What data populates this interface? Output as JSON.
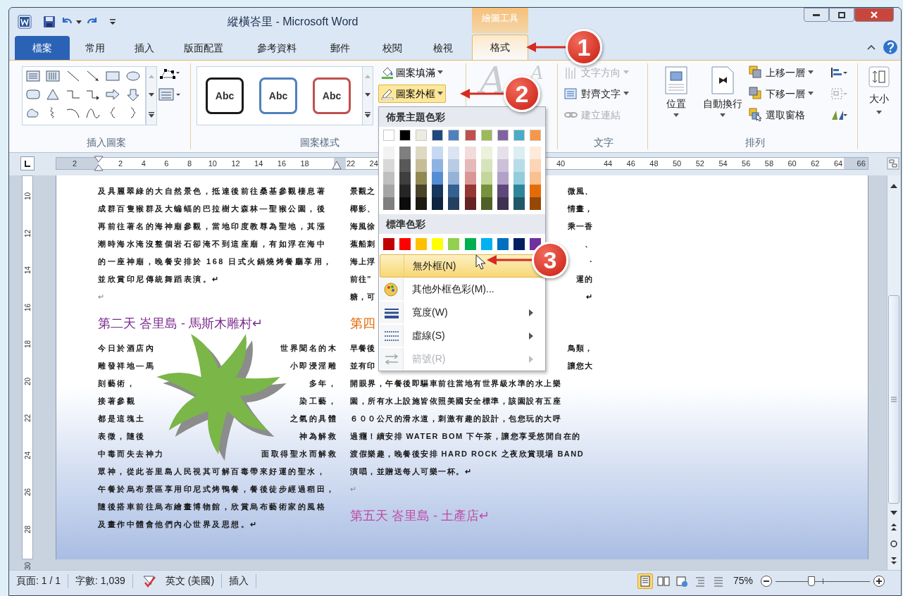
{
  "window": {
    "title": "縱橫峇里 - Microsoft Word",
    "contextual_tab_group": "繪圖工具"
  },
  "tabs": [
    {
      "label": "檔案",
      "kind": "file",
      "selected": false
    },
    {
      "label": "常用",
      "kind": "tab",
      "selected": false
    },
    {
      "label": "插入",
      "kind": "tab",
      "selected": false
    },
    {
      "label": "版面配置",
      "kind": "tab",
      "selected": false
    },
    {
      "label": "參考資料",
      "kind": "tab",
      "selected": false
    },
    {
      "label": "郵件",
      "kind": "tab",
      "selected": false
    },
    {
      "label": "校閱",
      "kind": "tab",
      "selected": false
    },
    {
      "label": "檢視",
      "kind": "tab",
      "selected": false
    },
    {
      "label": "格式",
      "kind": "contextual",
      "selected": true
    }
  ],
  "ribbon": {
    "insert_shapes": {
      "label": "插入圖案"
    },
    "shape_styles": {
      "label": "圖案樣式",
      "presets": [
        {
          "text": "Abc",
          "color": "#1a1a1a"
        },
        {
          "text": "Abc",
          "color": "#4f81bd"
        },
        {
          "text": "Abc",
          "color": "#c0504d"
        }
      ],
      "commands": [
        {
          "label": "圖案填滿",
          "pressed": false
        },
        {
          "label": "圖案外框",
          "pressed": true
        }
      ]
    },
    "wordart_styles": {
      "glyphs": [
        "A",
        "A"
      ]
    },
    "text_group": {
      "label": "文字",
      "commands": [
        {
          "label": "文字方向",
          "disabled": true
        },
        {
          "label": "對齊文字",
          "disabled": false
        },
        {
          "label": "建立連結",
          "disabled": true
        }
      ]
    },
    "arrange": {
      "label": "排列",
      "large": [
        {
          "label": "位置"
        },
        {
          "label": "自動換行"
        }
      ],
      "commands": [
        {
          "label": "上移一層"
        },
        {
          "label": "下移一層"
        },
        {
          "label": "選取窗格"
        }
      ]
    },
    "size": {
      "label": "大小"
    }
  },
  "callouts": [
    "1",
    "2",
    "3"
  ],
  "outline_menu": {
    "theme_header": "佈景主題色彩",
    "theme_colors": [
      {
        "color": "#ffffff",
        "shades": [
          {
            "color": "#f2f2f2"
          },
          {
            "color": "#d8d8d8"
          },
          {
            "color": "#bfbfbf"
          },
          {
            "color": "#a5a5a5"
          },
          {
            "color": "#7f7f7f"
          }
        ]
      },
      {
        "color": "#000000",
        "shades": [
          {
            "color": "#7f7f7f"
          },
          {
            "color": "#595959"
          },
          {
            "color": "#3f3f3f"
          },
          {
            "color": "#262626"
          },
          {
            "color": "#0c0c0c"
          }
        ]
      },
      {
        "color": "#eeece1",
        "shades": [
          {
            "color": "#ddd9c3"
          },
          {
            "color": "#c4bd97"
          },
          {
            "color": "#938953"
          },
          {
            "color": "#494429"
          },
          {
            "color": "#1d1b10"
          }
        ]
      },
      {
        "color": "#1f497d",
        "shades": [
          {
            "color": "#c6d9f0"
          },
          {
            "color": "#8db3e2"
          },
          {
            "color": "#548dd4"
          },
          {
            "color": "#17365d"
          },
          {
            "color": "#0f243e"
          }
        ]
      },
      {
        "color": "#4f81bd",
        "shades": [
          {
            "color": "#dbe5f1"
          },
          {
            "color": "#b8cce4"
          },
          {
            "color": "#95b3d7"
          },
          {
            "color": "#366092"
          },
          {
            "color": "#244061"
          }
        ]
      },
      {
        "color": "#c0504d",
        "shades": [
          {
            "color": "#f2dcdb"
          },
          {
            "color": "#e5b9b7"
          },
          {
            "color": "#d99694"
          },
          {
            "color": "#953734"
          },
          {
            "color": "#632423"
          }
        ]
      },
      {
        "color": "#9bbb59",
        "shades": [
          {
            "color": "#ebf1dd"
          },
          {
            "color": "#d7e3bc"
          },
          {
            "color": "#c3d69b"
          },
          {
            "color": "#76923c"
          },
          {
            "color": "#4f6128"
          }
        ]
      },
      {
        "color": "#8064a2",
        "shades": [
          {
            "color": "#e5e0ec"
          },
          {
            "color": "#ccc1d9"
          },
          {
            "color": "#b2a2c7"
          },
          {
            "color": "#5f497a"
          },
          {
            "color": "#3f3151"
          }
        ]
      },
      {
        "color": "#4bacc6",
        "shades": [
          {
            "color": "#dbeef3"
          },
          {
            "color": "#b7dde8"
          },
          {
            "color": "#92cddc"
          },
          {
            "color": "#31859b"
          },
          {
            "color": "#205867"
          }
        ]
      },
      {
        "color": "#f79646",
        "shades": [
          {
            "color": "#fdeada"
          },
          {
            "color": "#fbd5b5"
          },
          {
            "color": "#fac08f"
          },
          {
            "color": "#e36c09"
          },
          {
            "color": "#974806"
          }
        ]
      }
    ],
    "standard_header": "標準色彩",
    "standard_colors": [
      {
        "color": "#c00000"
      },
      {
        "color": "#ff0000"
      },
      {
        "color": "#ffc000"
      },
      {
        "color": "#ffff00"
      },
      {
        "color": "#92d050"
      },
      {
        "color": "#00b050"
      },
      {
        "color": "#00b0f0"
      },
      {
        "color": "#0070c0"
      },
      {
        "color": "#002060"
      },
      {
        "color": "#7030a0"
      }
    ],
    "items": [
      {
        "label": "無外框(N)",
        "kind": "none",
        "highlighted": true,
        "disabled": false,
        "submenu": false
      },
      {
        "label": "其他外框色彩(M)...",
        "kind": "more",
        "highlighted": false,
        "disabled": false,
        "submenu": false
      },
      {
        "label": "寬度(W)",
        "kind": "weight",
        "highlighted": false,
        "disabled": false,
        "submenu": true
      },
      {
        "label": "虛線(S)",
        "kind": "dashes",
        "highlighted": false,
        "disabled": false,
        "submenu": true
      },
      {
        "label": "箭號(R)",
        "kind": "arrows",
        "highlighted": false,
        "disabled": true,
        "submenu": true
      }
    ]
  },
  "ruler": {
    "segments": [
      [
        "2"
      ],
      [
        "2",
        "4",
        "6",
        "8",
        "10",
        "12",
        "14",
        "16",
        "18"
      ],
      [
        "22",
        "24"
      ],
      [
        "40"
      ],
      [
        "44",
        "46",
        "48",
        "50",
        "52",
        "54",
        "56",
        "58",
        "60",
        "62",
        "64",
        "66"
      ]
    ]
  },
  "vertical_ruler": [
    "10",
    "12",
    "14",
    "16",
    "18",
    "20",
    "22",
    "24",
    "26",
    "28",
    "30"
  ],
  "document": {
    "left_column": [
      {
        "kind": "line",
        "text": "及具麗翠綠的大自然景色，抵達後前往桑基參觀棲息著"
      },
      {
        "kind": "line",
        "text": "成群百隻猴群及大蝙蝠的巴拉樹大森林—聖猴公園，後"
      },
      {
        "kind": "line",
        "text": "再前往著名的海神廟參觀，當地印度教尊為聖地，其漲"
      },
      {
        "kind": "line",
        "text": "潮時海水淹沒整個岩石卻淹不到這座廟，有如浮在海中"
      },
      {
        "kind": "line",
        "text": "的一座神廟，晚餐安排於 168 日式火鍋燒烤餐廳享用，"
      },
      {
        "kind": "line",
        "text": "並欣賞印尼傳統舞蹈表演。↵"
      },
      {
        "kind": "mark",
        "text": "↵"
      },
      {
        "kind": "heading",
        "text": "第二天 峇里島 - 馬斯木雕村↵",
        "color": "#7b2c8e"
      },
      {
        "kind": "split",
        "left": "今日於酒店內",
        "right": "世界聞名的木"
      },
      {
        "kind": "split",
        "left": "雕發祥地—馬",
        "right": "小即浸淫雕"
      },
      {
        "kind": "split",
        "left": "刻藝術，",
        "right": "多年，"
      },
      {
        "kind": "split",
        "left": "接著參觀",
        "right": "染工藝，"
      },
      {
        "kind": "split",
        "left": "都是這塊土",
        "right": "之氣的具體"
      },
      {
        "kind": "split",
        "left": "表徵，隨後",
        "right": "神為解救"
      },
      {
        "kind": "split",
        "left": "中毒而失去神力",
        "right": "面取得聖水而解救"
      },
      {
        "kind": "line",
        "text": "眾神，從此峇里島人民視其可解百毒帶來好運的聖水，"
      },
      {
        "kind": "line",
        "text": "午餐於烏布景區享用印尼式烤鴨餐，餐後徒步經過稻田，"
      },
      {
        "kind": "line",
        "text": "隨後搭車前往烏布繪畫博物館，欣賞烏布藝術家的風格"
      },
      {
        "kind": "line",
        "text": "及畫作中體會他們內心世界及思想。↵"
      }
    ],
    "right_column": [
      {
        "kind": "split",
        "left": "景觀之",
        "right": "微風、"
      },
      {
        "kind": "split",
        "left": "椰影、",
        "right": "情畫，"
      },
      {
        "kind": "split",
        "left": "海風徐",
        "right": "乘一香"
      },
      {
        "kind": "split",
        "left": "蕉船刺",
        "right": "、"
      },
      {
        "kind": "split",
        "left": "海上浮",
        "right": "·"
      },
      {
        "kind": "split",
        "left": "前往”",
        "right": "運的"
      },
      {
        "kind": "split",
        "left": "糖，可",
        "right": "↵"
      },
      {
        "kind": "heading",
        "text": "第四",
        "color": "#e36c09"
      },
      {
        "kind": "split",
        "left": "早餐後",
        "right": "鳥類，"
      },
      {
        "kind": "split",
        "left": "並有印",
        "right": "讓您大"
      },
      {
        "kind": "line",
        "text": "開眼界，午餐後即驅車前往當地有世界級水準的水上樂"
      },
      {
        "kind": "line",
        "text": "園，所有水上設施皆依照美國安全標準，該園設有五座"
      },
      {
        "kind": "line",
        "text": "６００公尺的滑水道，刺激有趣的設計，包您玩的大呼"
      },
      {
        "kind": "line",
        "text": "過癮！續安排 WATER BOM 下午茶，讓您享受悠閒自在的"
      },
      {
        "kind": "line",
        "text": "渡假樂趣，晚餐後安排 HARD ROCK 之夜欣賞現場 BAND"
      },
      {
        "kind": "line",
        "text": "演唱，並贈送每人可樂一杯。↵"
      },
      {
        "kind": "mark",
        "text": "↵"
      },
      {
        "kind": "heading",
        "text": "第五天 峇里島 - 土產店↵",
        "color": "#c04ca8"
      }
    ]
  },
  "status_bar": {
    "page": "頁面: 1 / 1",
    "words": "字數: 1,039",
    "language": "英文 (美國)",
    "mode": "插入",
    "views": [
      {
        "kind": "print",
        "selected": true
      },
      {
        "kind": "reading",
        "selected": false
      },
      {
        "kind": "web",
        "selected": false
      },
      {
        "kind": "outline",
        "selected": false
      },
      {
        "kind": "draft",
        "selected": false
      }
    ],
    "zoom": "75%",
    "level": 0.38
  }
}
